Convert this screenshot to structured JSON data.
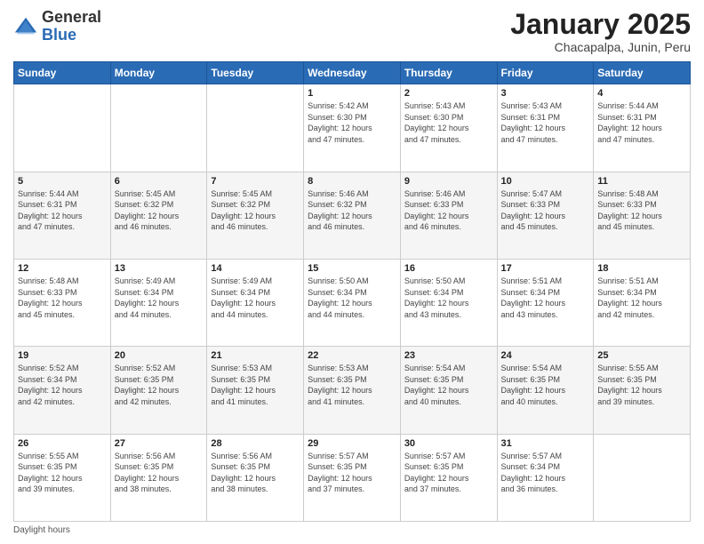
{
  "logo": {
    "general": "General",
    "blue": "Blue"
  },
  "title": {
    "month": "January 2025",
    "location": "Chacapalpa, Junin, Peru"
  },
  "days_of_week": [
    "Sunday",
    "Monday",
    "Tuesday",
    "Wednesday",
    "Thursday",
    "Friday",
    "Saturday"
  ],
  "weeks": [
    {
      "alt": false,
      "days": [
        {
          "num": "",
          "info": ""
        },
        {
          "num": "",
          "info": ""
        },
        {
          "num": "",
          "info": ""
        },
        {
          "num": "1",
          "info": "Sunrise: 5:42 AM\nSunset: 6:30 PM\nDaylight: 12 hours\nand 47 minutes."
        },
        {
          "num": "2",
          "info": "Sunrise: 5:43 AM\nSunset: 6:30 PM\nDaylight: 12 hours\nand 47 minutes."
        },
        {
          "num": "3",
          "info": "Sunrise: 5:43 AM\nSunset: 6:31 PM\nDaylight: 12 hours\nand 47 minutes."
        },
        {
          "num": "4",
          "info": "Sunrise: 5:44 AM\nSunset: 6:31 PM\nDaylight: 12 hours\nand 47 minutes."
        }
      ]
    },
    {
      "alt": true,
      "days": [
        {
          "num": "5",
          "info": "Sunrise: 5:44 AM\nSunset: 6:31 PM\nDaylight: 12 hours\nand 47 minutes."
        },
        {
          "num": "6",
          "info": "Sunrise: 5:45 AM\nSunset: 6:32 PM\nDaylight: 12 hours\nand 46 minutes."
        },
        {
          "num": "7",
          "info": "Sunrise: 5:45 AM\nSunset: 6:32 PM\nDaylight: 12 hours\nand 46 minutes."
        },
        {
          "num": "8",
          "info": "Sunrise: 5:46 AM\nSunset: 6:32 PM\nDaylight: 12 hours\nand 46 minutes."
        },
        {
          "num": "9",
          "info": "Sunrise: 5:46 AM\nSunset: 6:33 PM\nDaylight: 12 hours\nand 46 minutes."
        },
        {
          "num": "10",
          "info": "Sunrise: 5:47 AM\nSunset: 6:33 PM\nDaylight: 12 hours\nand 45 minutes."
        },
        {
          "num": "11",
          "info": "Sunrise: 5:48 AM\nSunset: 6:33 PM\nDaylight: 12 hours\nand 45 minutes."
        }
      ]
    },
    {
      "alt": false,
      "days": [
        {
          "num": "12",
          "info": "Sunrise: 5:48 AM\nSunset: 6:33 PM\nDaylight: 12 hours\nand 45 minutes."
        },
        {
          "num": "13",
          "info": "Sunrise: 5:49 AM\nSunset: 6:34 PM\nDaylight: 12 hours\nand 44 minutes."
        },
        {
          "num": "14",
          "info": "Sunrise: 5:49 AM\nSunset: 6:34 PM\nDaylight: 12 hours\nand 44 minutes."
        },
        {
          "num": "15",
          "info": "Sunrise: 5:50 AM\nSunset: 6:34 PM\nDaylight: 12 hours\nand 44 minutes."
        },
        {
          "num": "16",
          "info": "Sunrise: 5:50 AM\nSunset: 6:34 PM\nDaylight: 12 hours\nand 43 minutes."
        },
        {
          "num": "17",
          "info": "Sunrise: 5:51 AM\nSunset: 6:34 PM\nDaylight: 12 hours\nand 43 minutes."
        },
        {
          "num": "18",
          "info": "Sunrise: 5:51 AM\nSunset: 6:34 PM\nDaylight: 12 hours\nand 42 minutes."
        }
      ]
    },
    {
      "alt": true,
      "days": [
        {
          "num": "19",
          "info": "Sunrise: 5:52 AM\nSunset: 6:34 PM\nDaylight: 12 hours\nand 42 minutes."
        },
        {
          "num": "20",
          "info": "Sunrise: 5:52 AM\nSunset: 6:35 PM\nDaylight: 12 hours\nand 42 minutes."
        },
        {
          "num": "21",
          "info": "Sunrise: 5:53 AM\nSunset: 6:35 PM\nDaylight: 12 hours\nand 41 minutes."
        },
        {
          "num": "22",
          "info": "Sunrise: 5:53 AM\nSunset: 6:35 PM\nDaylight: 12 hours\nand 41 minutes."
        },
        {
          "num": "23",
          "info": "Sunrise: 5:54 AM\nSunset: 6:35 PM\nDaylight: 12 hours\nand 40 minutes."
        },
        {
          "num": "24",
          "info": "Sunrise: 5:54 AM\nSunset: 6:35 PM\nDaylight: 12 hours\nand 40 minutes."
        },
        {
          "num": "25",
          "info": "Sunrise: 5:55 AM\nSunset: 6:35 PM\nDaylight: 12 hours\nand 39 minutes."
        }
      ]
    },
    {
      "alt": false,
      "days": [
        {
          "num": "26",
          "info": "Sunrise: 5:55 AM\nSunset: 6:35 PM\nDaylight: 12 hours\nand 39 minutes."
        },
        {
          "num": "27",
          "info": "Sunrise: 5:56 AM\nSunset: 6:35 PM\nDaylight: 12 hours\nand 38 minutes."
        },
        {
          "num": "28",
          "info": "Sunrise: 5:56 AM\nSunset: 6:35 PM\nDaylight: 12 hours\nand 38 minutes."
        },
        {
          "num": "29",
          "info": "Sunrise: 5:57 AM\nSunset: 6:35 PM\nDaylight: 12 hours\nand 37 minutes."
        },
        {
          "num": "30",
          "info": "Sunrise: 5:57 AM\nSunset: 6:35 PM\nDaylight: 12 hours\nand 37 minutes."
        },
        {
          "num": "31",
          "info": "Sunrise: 5:57 AM\nSunset: 6:34 PM\nDaylight: 12 hours\nand 36 minutes."
        },
        {
          "num": "",
          "info": ""
        }
      ]
    }
  ],
  "footer": {
    "note": "Daylight hours"
  },
  "colors": {
    "header_bg": "#2a6bb5",
    "alt_row": "#f5f5f5",
    "white_row": "#ffffff"
  }
}
